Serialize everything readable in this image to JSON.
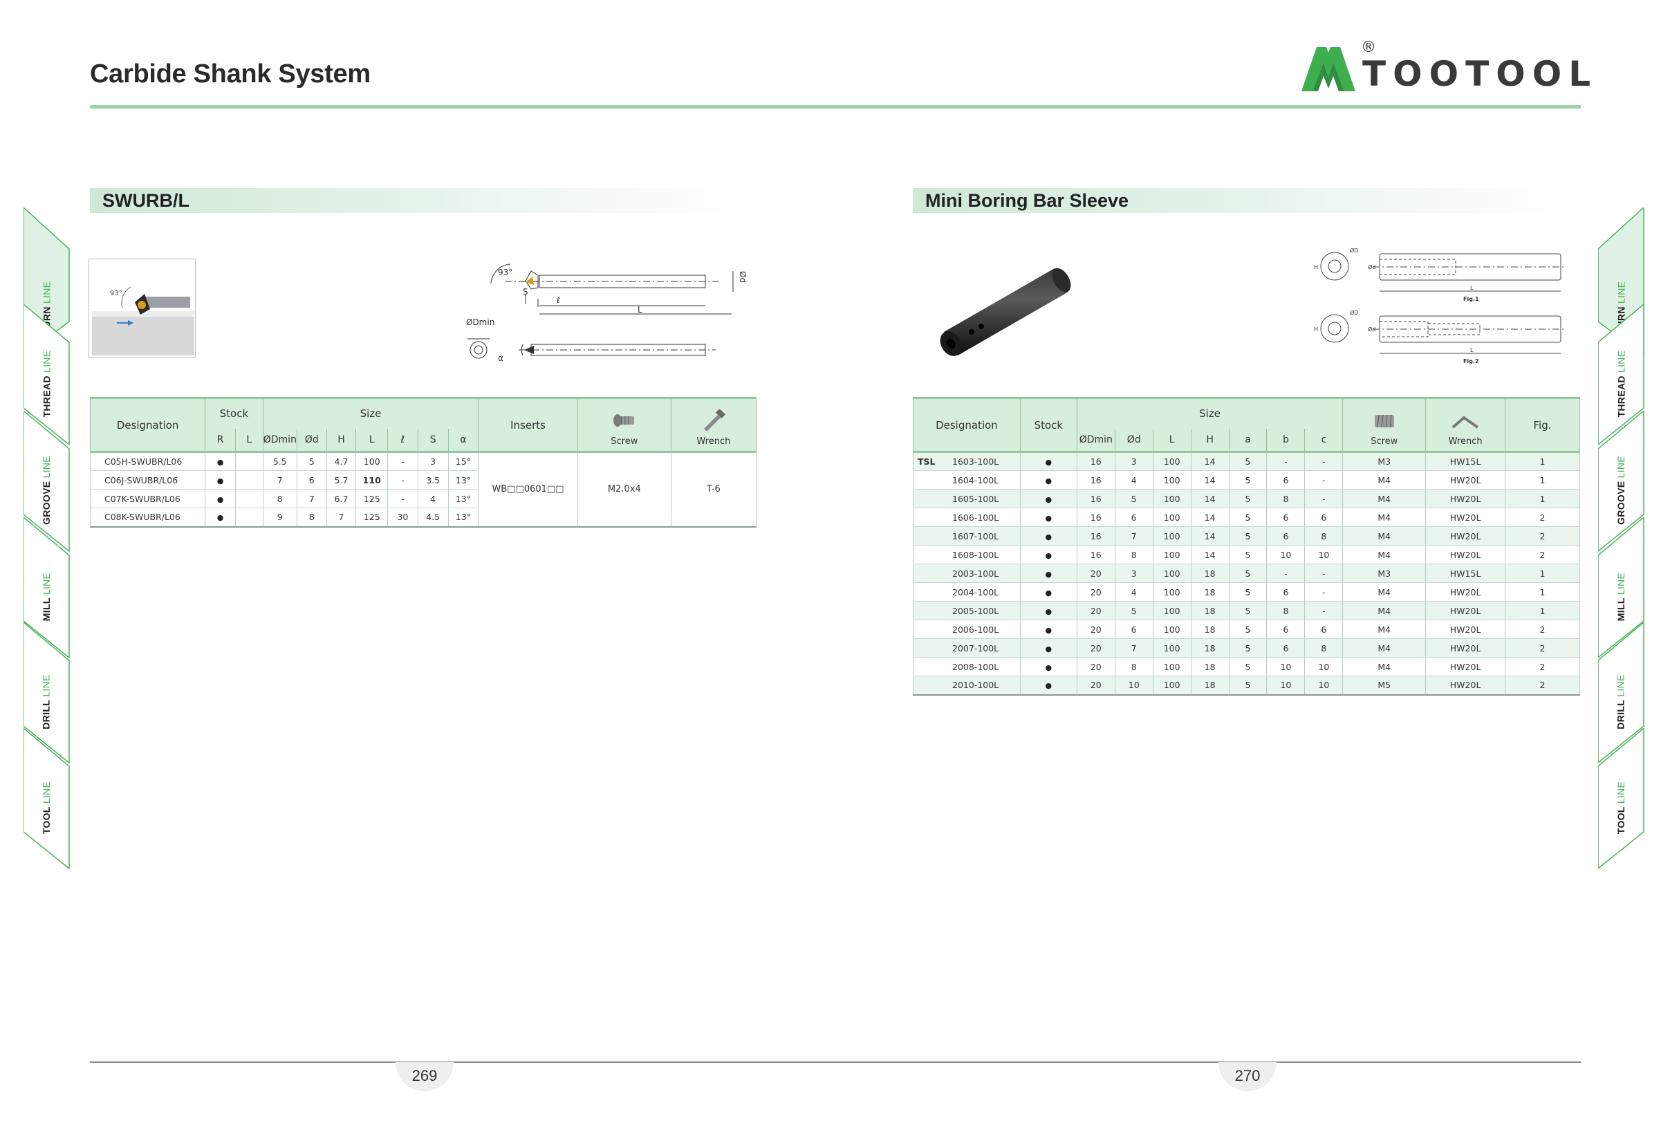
{
  "header": {
    "title": "Carbide Shank System",
    "logo_text": "TOOTOOL",
    "logo_reg": "®"
  },
  "colors": {
    "accent": "#4db35f",
    "header_fill": "#d7eedd",
    "rule": "#9fd3ac"
  },
  "tabs": [
    {
      "main": "TURN",
      "sub": " LINE"
    },
    {
      "main": "THREAD",
      "sub": " LINE"
    },
    {
      "main": "GROOVE",
      "sub": " LINE"
    },
    {
      "main": "MILL",
      "sub": " LINE"
    },
    {
      "main": "DRILL",
      "sub": " LINE"
    },
    {
      "main": "TOOL",
      "sub": " LINE"
    }
  ],
  "left": {
    "section_title": "SWURB/L",
    "drawing_labels": {
      "angle": "93°",
      "d": "Ød",
      "l": "ℓ",
      "L": "L",
      "S": "S",
      "dmin": "ØDmin",
      "alpha": "α"
    },
    "headers": {
      "designation": "Designation",
      "stock": "Stock",
      "size": "Size",
      "inserts": "Inserts",
      "screw": "Screw",
      "wrench": "Wrench",
      "stock_cols": [
        "R",
        "L"
      ],
      "size_cols": [
        "ØDmin",
        "Ød",
        "H",
        "L",
        "ℓ",
        "S",
        "α"
      ]
    },
    "rows": [
      {
        "designation": "C05H-SWUBR/L06",
        "dmin": "5.5",
        "d": "5",
        "H": "4.7",
        "L": "100",
        "l": "-",
        "S": "3",
        "a": "15°"
      },
      {
        "designation": "C06J-SWUBR/L06",
        "dmin": "7",
        "d": "6",
        "H": "5.7",
        "L": "110",
        "l": "-",
        "S": "3.5",
        "a": "13°"
      },
      {
        "designation": "C07K-SWUBR/L06",
        "dmin": "8",
        "d": "7",
        "H": "6.7",
        "L": "125",
        "l": "-",
        "S": "4",
        "a": "13°"
      },
      {
        "designation": "C08K-SWUBR/L06",
        "dmin": "9",
        "d": "8",
        "H": "7",
        "L": "125",
        "l": "30",
        "S": "4.5",
        "a": "13°"
      }
    ],
    "inserts": "WB□□0601□□",
    "screw": "M2.0x4",
    "wrench": "T-6"
  },
  "right": {
    "section_title": "Mini Boring Bar Sleeve",
    "drawing_labels": {
      "fig1": "Fig.1",
      "fig2": "Fig.2",
      "D": "ØD",
      "d": "Ød",
      "H": "H",
      "L": "L"
    },
    "headers": {
      "designation": "Designation",
      "stock": "Stock",
      "size": "Size",
      "screw": "Screw",
      "wrench": "Wrench",
      "fig": "Fig.",
      "size_cols": [
        "ØDmin",
        "Ød",
        "L",
        "H",
        "a",
        "b",
        "c"
      ]
    },
    "prefix": "TSL",
    "rows": [
      {
        "designation": "1603-100L",
        "dmin": "16",
        "d": "3",
        "L": "100",
        "H": "14",
        "a": "5",
        "b": "-",
        "c": "-",
        "screw": "M3",
        "wrench": "HW15L",
        "fig": "1"
      },
      {
        "designation": "1604-100L",
        "dmin": "16",
        "d": "4",
        "L": "100",
        "H": "14",
        "a": "5",
        "b": "6",
        "c": "-",
        "screw": "M4",
        "wrench": "HW20L",
        "fig": "1"
      },
      {
        "designation": "1605-100L",
        "dmin": "16",
        "d": "5",
        "L": "100",
        "H": "14",
        "a": "5",
        "b": "8",
        "c": "-",
        "screw": "M4",
        "wrench": "HW20L",
        "fig": "1"
      },
      {
        "designation": "1606-100L",
        "dmin": "16",
        "d": "6",
        "L": "100",
        "H": "14",
        "a": "5",
        "b": "6",
        "c": "6",
        "screw": "M4",
        "wrench": "HW20L",
        "fig": "2"
      },
      {
        "designation": "1607-100L",
        "dmin": "16",
        "d": "7",
        "L": "100",
        "H": "14",
        "a": "5",
        "b": "6",
        "c": "8",
        "screw": "M4",
        "wrench": "HW20L",
        "fig": "2"
      },
      {
        "designation": "1608-100L",
        "dmin": "16",
        "d": "8",
        "L": "100",
        "H": "14",
        "a": "5",
        "b": "10",
        "c": "10",
        "screw": "M4",
        "wrench": "HW20L",
        "fig": "2"
      },
      {
        "designation": "2003-100L",
        "dmin": "20",
        "d": "3",
        "L": "100",
        "H": "18",
        "a": "5",
        "b": "-",
        "c": "-",
        "screw": "M3",
        "wrench": "HW15L",
        "fig": "1"
      },
      {
        "designation": "2004-100L",
        "dmin": "20",
        "d": "4",
        "L": "100",
        "H": "18",
        "a": "5",
        "b": "6",
        "c": "-",
        "screw": "M4",
        "wrench": "HW20L",
        "fig": "1"
      },
      {
        "designation": "2005-100L",
        "dmin": "20",
        "d": "5",
        "L": "100",
        "H": "18",
        "a": "5",
        "b": "8",
        "c": "-",
        "screw": "M4",
        "wrench": "HW20L",
        "fig": "1"
      },
      {
        "designation": "2006-100L",
        "dmin": "20",
        "d": "6",
        "L": "100",
        "H": "18",
        "a": "5",
        "b": "6",
        "c": "6",
        "screw": "M4",
        "wrench": "HW20L",
        "fig": "2"
      },
      {
        "designation": "2007-100L",
        "dmin": "20",
        "d": "7",
        "L": "100",
        "H": "18",
        "a": "5",
        "b": "6",
        "c": "8",
        "screw": "M4",
        "wrench": "HW20L",
        "fig": "2"
      },
      {
        "designation": "2008-100L",
        "dmin": "20",
        "d": "8",
        "L": "100",
        "H": "18",
        "a": "5",
        "b": "10",
        "c": "10",
        "screw": "M4",
        "wrench": "HW20L",
        "fig": "2"
      },
      {
        "designation": "2010-100L",
        "dmin": "20",
        "d": "10",
        "L": "100",
        "H": "18",
        "a": "5",
        "b": "10",
        "c": "10",
        "screw": "M5",
        "wrench": "HW20L",
        "fig": "2"
      }
    ]
  },
  "footer": {
    "page_left": "269",
    "page_right": "270"
  }
}
